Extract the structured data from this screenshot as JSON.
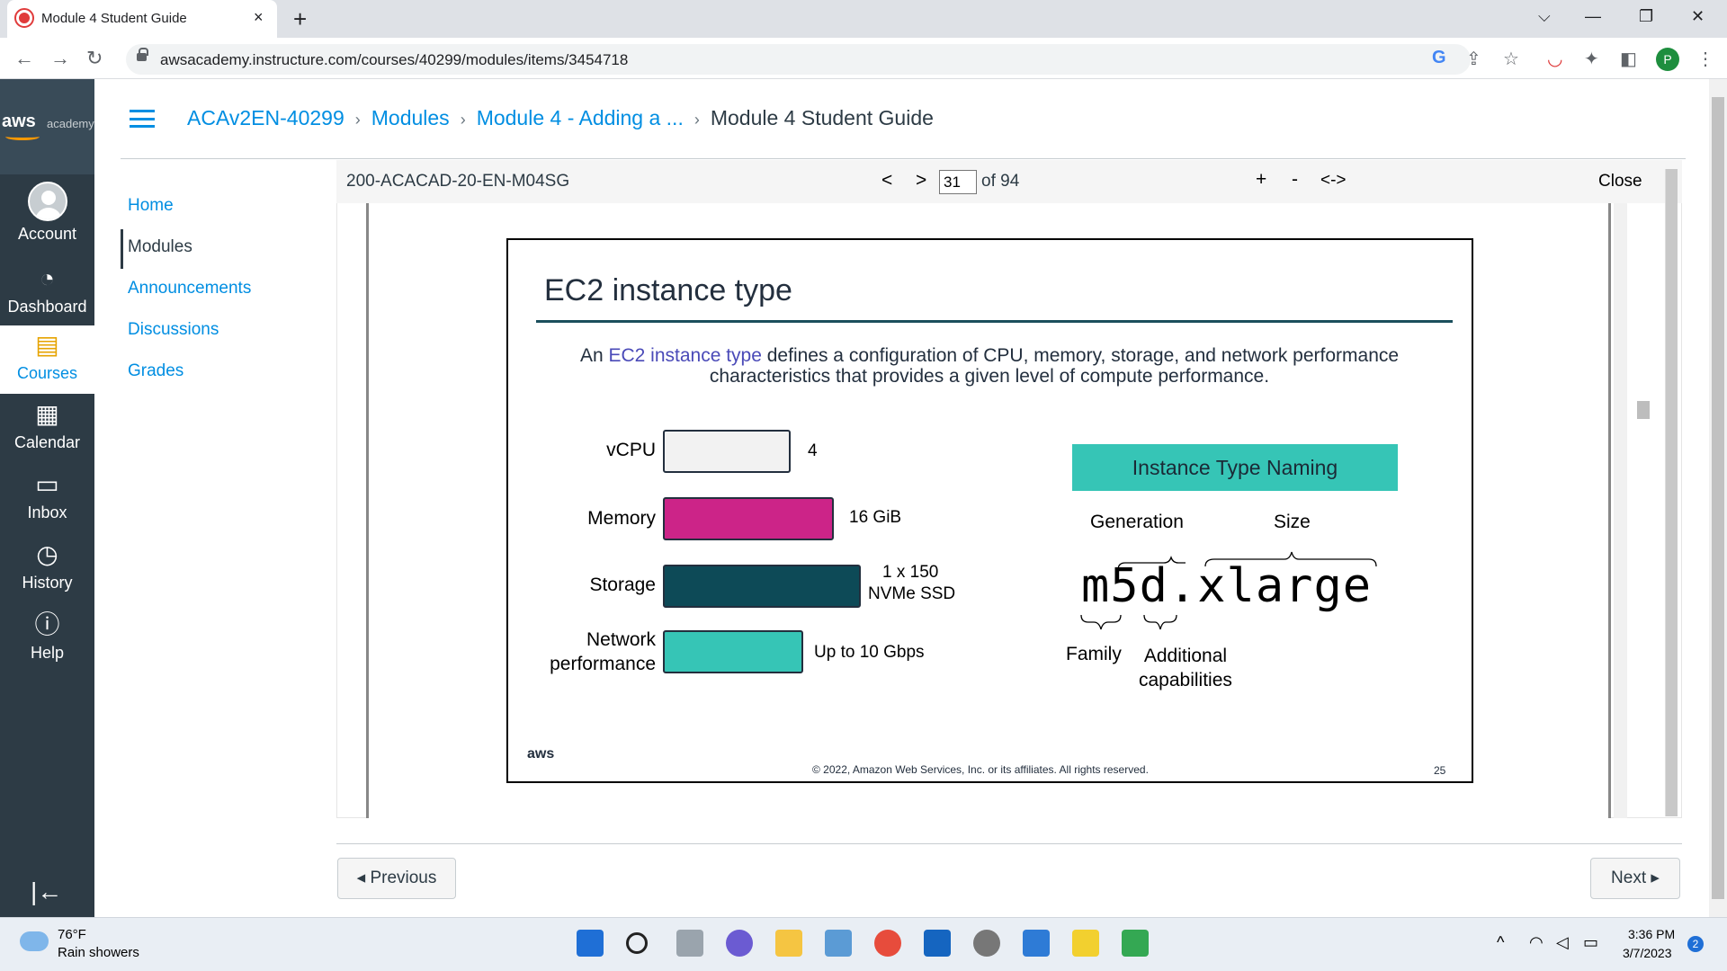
{
  "browser": {
    "tab_title": "Module 4 Student Guide",
    "tab_close": "×",
    "new_tab": "+",
    "url": "awsacademy.instructure.com/courses/40299/modules/items/3454718",
    "profile_initial": "P",
    "window_controls": {
      "dropdown": "⌵",
      "minimize": "—",
      "restore": "❐",
      "close": "✕"
    },
    "nav": {
      "back": "←",
      "forward": "→",
      "reload": "↻"
    },
    "toolbar_icons": [
      "google-icon",
      "share-icon",
      "star-icon",
      "pocket-icon",
      "extensions-icon",
      "sidepanel-icon",
      "menu-icon"
    ]
  },
  "global_nav": {
    "logo_text": "aws",
    "logo_sub": "academy",
    "items": [
      {
        "label": "Account",
        "icon": "avatar"
      },
      {
        "label": "Dashboard",
        "icon": "dashboard-icon"
      },
      {
        "label": "Courses",
        "icon": "courses-icon"
      },
      {
        "label": "Calendar",
        "icon": "calendar-icon"
      },
      {
        "label": "Inbox",
        "icon": "inbox-icon"
      },
      {
        "label": "History",
        "icon": "history-icon"
      },
      {
        "label": "Help",
        "icon": "help-icon"
      }
    ],
    "collapse_icon": "|←"
  },
  "breadcrumb": {
    "items": [
      "ACAv2EN-40299",
      "Modules",
      "Module 4 - Adding a ..."
    ],
    "current": "Module 4 Student Guide"
  },
  "course_nav": [
    "Home",
    "Modules",
    "Announcements",
    "Discussions",
    "Grades"
  ],
  "viewer": {
    "doc_id": "200-ACACAD-20-EN-M04SG",
    "prev": "<",
    "next": ">",
    "page": "31",
    "of_total": "of 94",
    "zoom_in": "+",
    "zoom_out": "-",
    "fit": "<->",
    "close": "Close"
  },
  "slide": {
    "title": "EC2 instance type",
    "desc_pre": "An ",
    "desc_link": "EC2 instance type",
    "desc_post": " defines a configuration of CPU, memory, storage, and network performance characteristics that provides a given level of compute performance.",
    "rows": [
      {
        "label": "vCPU",
        "value": "4",
        "color": "#f2f2f2"
      },
      {
        "label": "Memory",
        "value": "16 GiB",
        "color": "#cc2488"
      },
      {
        "label": "Storage",
        "value_line1": "1 x 150",
        "value_line2": "NVMe SSD",
        "color": "#0d4a57"
      },
      {
        "label_line1": "Network",
        "label_line2": "performance",
        "value": "Up to 10 Gbps",
        "color": "#36c5b6"
      }
    ],
    "naming_title": "Instance Type Naming",
    "generation": "Generation",
    "size": "Size",
    "example_name": "m5d.xlarge",
    "family": "Family",
    "additional_line1": "Additional",
    "additional_line2": "capabilities",
    "aws_logo": "aws",
    "copyright": "© 2022, Amazon Web Services, Inc. or its affiliates. All rights reserved.",
    "slide_number": "25"
  },
  "footer_nav": {
    "previous": "◂ Previous",
    "next": "Next ▸"
  },
  "taskbar": {
    "weather_temp": "76°F",
    "weather_desc": "Rain showers",
    "time": "3:36 PM",
    "date": "3/7/2023",
    "notifications": "2"
  }
}
